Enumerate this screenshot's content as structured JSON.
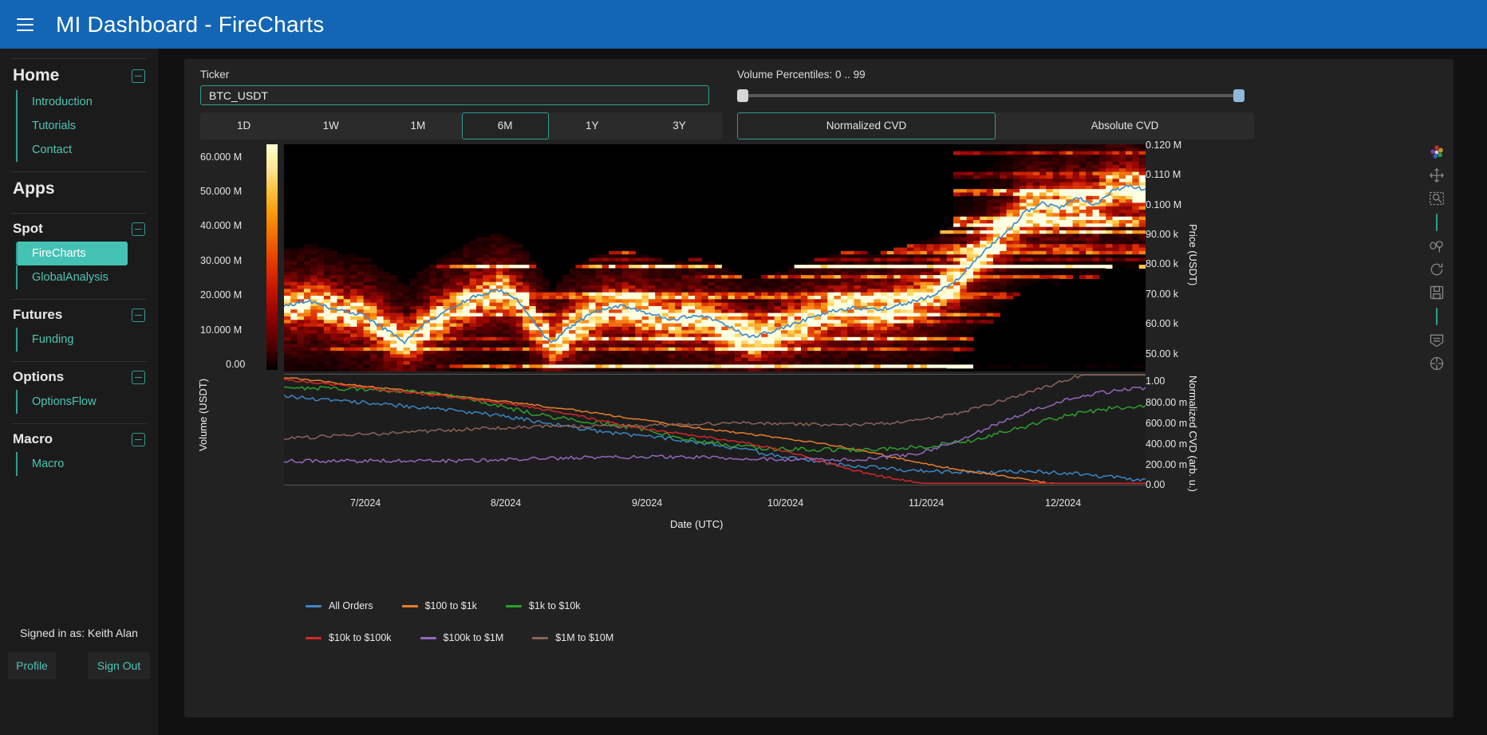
{
  "header": {
    "menu_icon": "hamburger-icon",
    "title": "MI Dashboard  -  FireCharts"
  },
  "sidebar": {
    "groups": [
      {
        "title": "Home",
        "collapsible": true,
        "items": [
          {
            "label": "Introduction",
            "active": false
          },
          {
            "label": "Tutorials",
            "active": false
          },
          {
            "label": "Contact",
            "active": false
          }
        ]
      },
      {
        "title": "Apps",
        "collapsible": false,
        "items": []
      },
      {
        "title": "Spot",
        "collapsible": true,
        "items": [
          {
            "label": "FireCharts",
            "active": true
          },
          {
            "label": "GlobalAnalysis",
            "active": false
          }
        ]
      },
      {
        "title": "Futures",
        "collapsible": true,
        "items": [
          {
            "label": "Funding",
            "active": false
          }
        ]
      },
      {
        "title": "Options",
        "collapsible": true,
        "items": [
          {
            "label": "OptionsFlow",
            "active": false
          }
        ]
      },
      {
        "title": "Macro",
        "collapsible": true,
        "items": [
          {
            "label": "Macro",
            "active": false
          }
        ]
      }
    ],
    "signed_in_text": "Signed in as: Keith Alan",
    "profile_label": "Profile",
    "signout_label": "Sign Out"
  },
  "controls": {
    "ticker_label": "Ticker",
    "ticker_value": "BTC_USDT",
    "ticker_placeholder": "BTC_USDT",
    "volume_percentiles_label": "Volume Percentiles: 0 .. 99",
    "volume_percentiles_min": 0,
    "volume_percentiles_max": 99,
    "period_tabs": [
      {
        "label": "1D",
        "selected": false
      },
      {
        "label": "1W",
        "selected": false
      },
      {
        "label": "1M",
        "selected": false
      },
      {
        "label": "6M",
        "selected": true
      },
      {
        "label": "1Y",
        "selected": false
      },
      {
        "label": "3Y",
        "selected": false
      }
    ],
    "cvd_tabs": [
      {
        "label": "Normalized CVD",
        "selected": true
      },
      {
        "label": "Absolute CVD",
        "selected": false
      }
    ]
  },
  "toolbar": {
    "icons": [
      "palette-icon",
      "pan-icon",
      "box-zoom-icon",
      "lasso-select-icon",
      "reset-icon",
      "save-icon",
      "hover-icon",
      "crosshair-icon"
    ]
  },
  "chart_data": {
    "type": "heatmap",
    "title": "",
    "xlabel": "Date (UTC)",
    "x_ticks": [
      "7/2024",
      "8/2024",
      "9/2024",
      "10/2024",
      "11/2024",
      "12/2024"
    ],
    "upper_panel": {
      "left_axis": {
        "label": "Volume (USDT)",
        "ticks": [
          "60.000 M",
          "50.000 M",
          "40.000 M",
          "30.000 M",
          "20.000 M",
          "10.000 M",
          "0.00"
        ],
        "values": [
          60000000,
          50000000,
          40000000,
          30000000,
          20000000,
          10000000,
          0
        ]
      },
      "right_axis": {
        "label": "Price (USDT)",
        "ticks": [
          "0.120 M",
          "0.110 M",
          "0.100 M",
          "90.00 k",
          "80.00 k",
          "70.00 k",
          "60.00 k",
          "50.00 k"
        ],
        "values": [
          120000,
          110000,
          100000,
          90000,
          80000,
          70000,
          60000,
          50000
        ]
      },
      "colorbar": {
        "colormap": "inferno",
        "low": "#000000",
        "high": "#ffffd4"
      },
      "price_line": {
        "name": "Price",
        "color": "#4a8fc4",
        "points": [
          [
            0.0,
            0.29
          ],
          [
            0.03,
            0.31
          ],
          [
            0.06,
            0.27
          ],
          [
            0.09,
            0.25
          ],
          [
            0.12,
            0.18
          ],
          [
            0.14,
            0.13
          ],
          [
            0.16,
            0.2
          ],
          [
            0.19,
            0.27
          ],
          [
            0.22,
            0.33
          ],
          [
            0.25,
            0.36
          ],
          [
            0.27,
            0.32
          ],
          [
            0.29,
            0.22
          ],
          [
            0.31,
            0.12
          ],
          [
            0.33,
            0.19
          ],
          [
            0.36,
            0.26
          ],
          [
            0.39,
            0.29
          ],
          [
            0.42,
            0.26
          ],
          [
            0.45,
            0.23
          ],
          [
            0.48,
            0.25
          ],
          [
            0.51,
            0.21
          ],
          [
            0.54,
            0.15
          ],
          [
            0.57,
            0.18
          ],
          [
            0.6,
            0.22
          ],
          [
            0.63,
            0.26
          ],
          [
            0.66,
            0.28
          ],
          [
            0.69,
            0.27
          ],
          [
            0.72,
            0.3
          ],
          [
            0.75,
            0.33
          ],
          [
            0.78,
            0.4
          ],
          [
            0.81,
            0.52
          ],
          [
            0.84,
            0.62
          ],
          [
            0.86,
            0.7
          ],
          [
            0.88,
            0.74
          ],
          [
            0.9,
            0.72
          ],
          [
            0.92,
            0.77
          ],
          [
            0.94,
            0.73
          ],
          [
            0.96,
            0.79
          ],
          [
            0.98,
            0.82
          ],
          [
            1.0,
            0.8
          ]
        ]
      }
    },
    "lower_panel": {
      "right_axis": {
        "label": "Normalized CVD (arb. u.)",
        "ticks": [
          "1.00",
          "800.00 m",
          "600.00 m",
          "400.00 m",
          "200.00 m",
          "0.00"
        ],
        "values": [
          1.0,
          0.8,
          0.6,
          0.4,
          0.2,
          0.0
        ]
      },
      "series": [
        {
          "name": "All Orders",
          "color": "#3b86c4"
        },
        {
          "name": "$100 to $1k",
          "color": "#e87e2a"
        },
        {
          "name": "$1k to $10k",
          "color": "#2ca02c"
        },
        {
          "name": "$10k to $100k",
          "color": "#d62728"
        },
        {
          "name": "$100k to $1M",
          "color": "#9467bd"
        },
        {
          "name": "$1M to $10M",
          "color": "#8c6358"
        }
      ]
    },
    "legend_position": "bottom-left",
    "grid": false
  }
}
